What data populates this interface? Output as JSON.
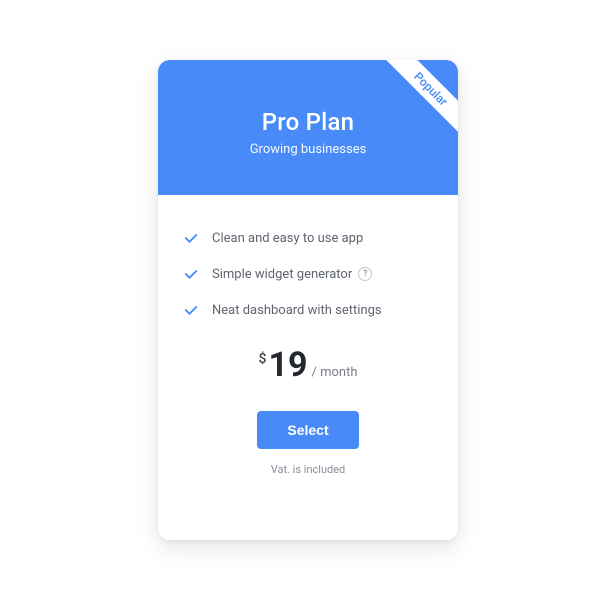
{
  "ribbon": "Popular",
  "title": "Pro Plan",
  "subtitle": "Growing businesses",
  "features": [
    "Clean and easy to use app",
    "Simple widget generator",
    "Neat dashboard with settings"
  ],
  "help_marker": "?",
  "price": {
    "currency": "$",
    "amount": "19",
    "period": "/ month"
  },
  "cta": "Select",
  "vat_note": "Vat. is included",
  "colors": {
    "primary": "#488bf8"
  }
}
